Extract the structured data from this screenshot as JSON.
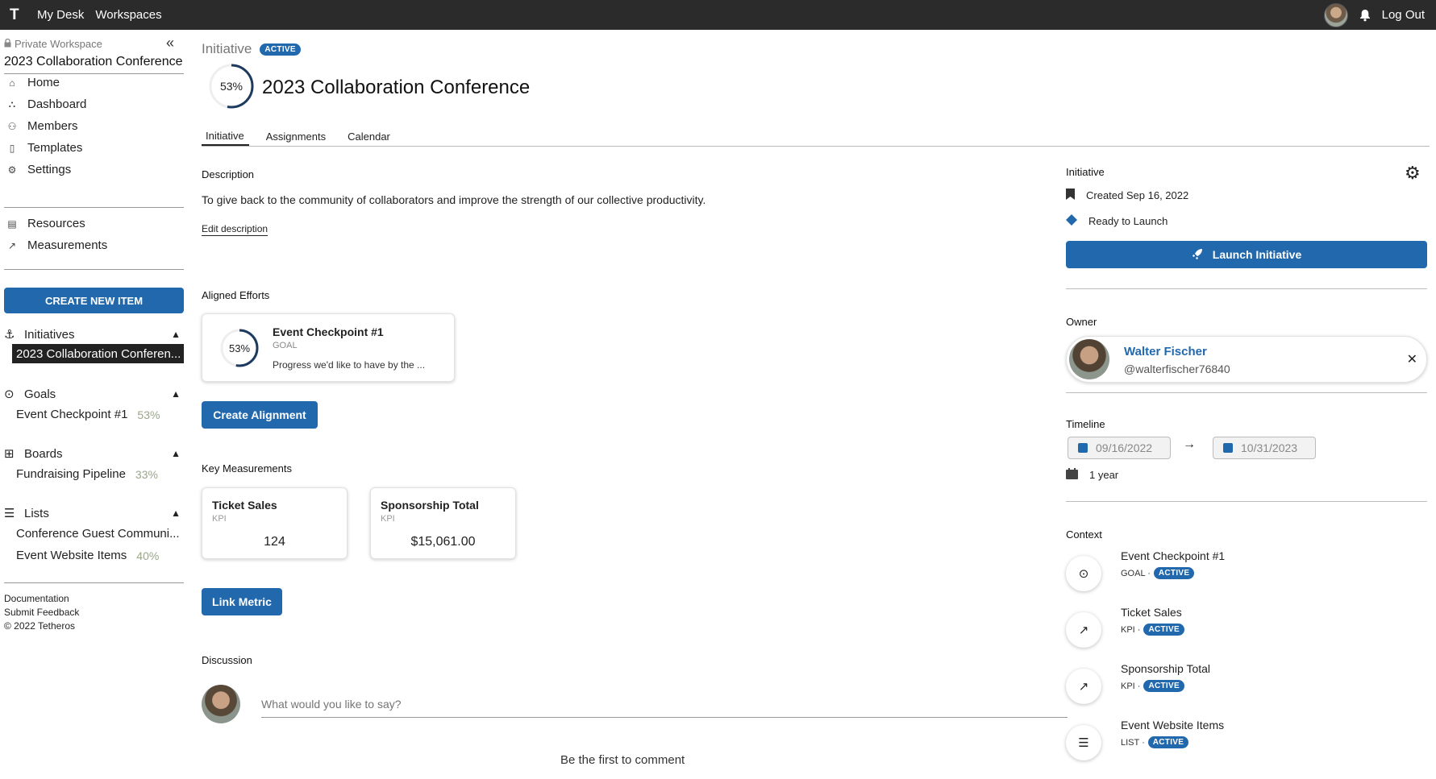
{
  "topbar": {
    "logo": "T",
    "nav": [
      "My Desk",
      "Workspaces"
    ],
    "logout": "Log Out"
  },
  "sidebar": {
    "workspace_label": "Private Workspace",
    "collapse": "«",
    "workspace_title": "2023 Collaboration Conference",
    "menu": [
      {
        "label": "Home",
        "icon": "home-icon"
      },
      {
        "label": "Dashboard",
        "icon": "dashboard-icon"
      },
      {
        "label": "Members",
        "icon": "members-icon"
      },
      {
        "label": "Templates",
        "icon": "templates-icon"
      },
      {
        "label": "Settings",
        "icon": "settings-icon"
      }
    ],
    "menu2": [
      {
        "label": "Resources",
        "icon": "resources-icon"
      },
      {
        "label": "Measurements",
        "icon": "measurements-icon"
      }
    ],
    "create_button": "CREATE NEW ITEM",
    "sections": {
      "initiatives": {
        "title": "Initiatives",
        "items": [
          {
            "label": "2023 Collaboration Conferen...",
            "pct": ""
          }
        ]
      },
      "goals": {
        "title": "Goals",
        "items": [
          {
            "label": "Event Checkpoint #1",
            "pct": "53%"
          }
        ]
      },
      "boards": {
        "title": "Boards",
        "items": [
          {
            "label": "Fundraising Pipeline",
            "pct": "33%"
          }
        ]
      },
      "lists": {
        "title": "Lists",
        "items": [
          {
            "label": "Conference Guest Communi...",
            "pct": ""
          },
          {
            "label": "Event Website Items",
            "pct": "40%"
          }
        ]
      }
    },
    "footer": [
      "Documentation",
      "Submit Feedback",
      "© 2022 Tetheros"
    ]
  },
  "main": {
    "crumb": "Initiative",
    "status_badge": "ACTIVE",
    "progress_label": "53%",
    "progress_value": 0.53,
    "title": "2023 Collaboration Conference",
    "tabs": [
      "Initiative",
      "Assignments",
      "Calendar"
    ],
    "description_heading": "Description",
    "description": "To give back to the community of collaborators and improve the strength of our collective productivity.",
    "edit_description": "Edit description",
    "aligned_heading": "Aligned Efforts",
    "aligned": {
      "name": "Event Checkpoint #1",
      "type": "GOAL",
      "progress_label": "53%",
      "progress_value": 0.53,
      "text": "Progress we'd like to have by the ..."
    },
    "create_alignment": "Create Alignment",
    "measurements_heading": "Key Measurements",
    "kpis": [
      {
        "name": "Ticket Sales",
        "type": "KPI",
        "value": "124"
      },
      {
        "name": "Sponsorship Total",
        "type": "KPI",
        "value": "$15,061.00"
      }
    ],
    "link_metric": "Link Metric",
    "discussion_heading": "Discussion",
    "comment_placeholder": "What would you like to say?",
    "first_comment": "Be the first to comment"
  },
  "right": {
    "initiative_heading": "Initiative",
    "created": "Created Sep 16, 2022",
    "status": "Ready to Launch",
    "launch_button": "Launch Initiative",
    "owner_heading": "Owner",
    "owner_name": "Walter Fischer",
    "owner_handle": "@walterfischer76840",
    "timeline_heading": "Timeline",
    "start_date": "09/16/2022",
    "end_date": "10/31/2023",
    "arrow": "→",
    "duration": "1 year",
    "context_heading": "Context",
    "context": [
      {
        "name": "Event Checkpoint #1",
        "type": "GOAL ·",
        "badge": "ACTIVE",
        "icon": "goal-icon"
      },
      {
        "name": "Ticket Sales",
        "type": "KPI ·",
        "badge": "ACTIVE",
        "icon": "trend-icon"
      },
      {
        "name": "Sponsorship Total",
        "type": "KPI ·",
        "badge": "ACTIVE",
        "icon": "trend-icon"
      },
      {
        "name": "Event Website Items",
        "type": "LIST ·",
        "badge": "ACTIVE",
        "icon": "list-icon"
      }
    ]
  },
  "colors": {
    "accent": "#2268ad",
    "topbar": "#2b2b2b",
    "pct_muted": "#9aa58a"
  }
}
